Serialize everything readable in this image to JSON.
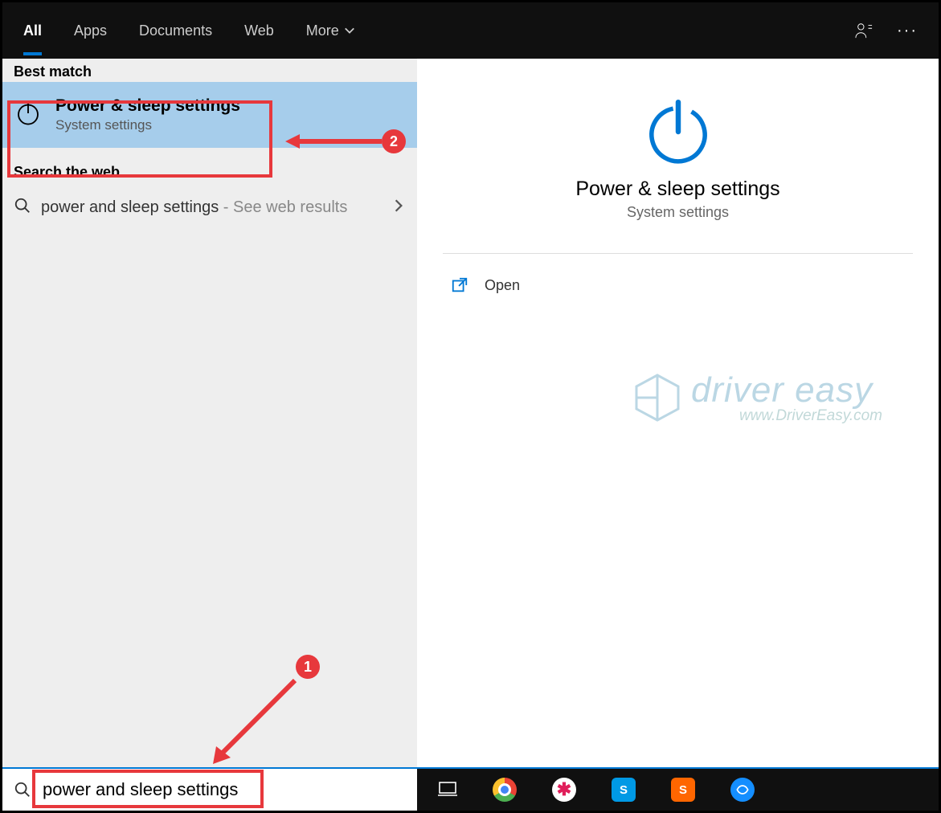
{
  "header": {
    "tabs": [
      "All",
      "Apps",
      "Documents",
      "Web",
      "More"
    ]
  },
  "left": {
    "best_match_label": "Best match",
    "best_match": {
      "title": "Power & sleep settings",
      "sub": "System settings"
    },
    "web_label": "Search the web",
    "web_item": {
      "query": "power and sleep settings",
      "suffix": " - See web results"
    }
  },
  "preview": {
    "title": "Power & sleep settings",
    "sub": "System settings",
    "open": "Open"
  },
  "watermark": {
    "brand": "driver easy",
    "url": "www.DriverEasy.com"
  },
  "search": {
    "value": "power and sleep settings"
  },
  "annotations": {
    "one": "1",
    "two": "2"
  }
}
